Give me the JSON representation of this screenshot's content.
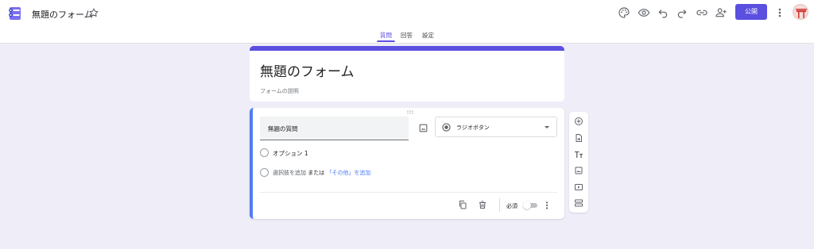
{
  "header": {
    "doc_title": "無題のフォーム",
    "publish_label": "公開",
    "tools": [
      "palette-icon",
      "eye-icon",
      "undo-icon",
      "redo-icon",
      "link-icon",
      "person-add-icon"
    ]
  },
  "tabs": [
    {
      "label": "質問",
      "active": true
    },
    {
      "label": "回答",
      "active": false
    },
    {
      "label": "設定",
      "active": false
    }
  ],
  "form": {
    "title": "無題のフォーム",
    "description_placeholder": "フォームの説明"
  },
  "question": {
    "title": "無題の質問",
    "type": "ラジオボタン",
    "options": [
      "オプション 1"
    ],
    "add_option": "選択肢を追加",
    "or": "または",
    "add_other": "「その他」を追加",
    "required_label": "必須",
    "required": false
  },
  "side_toolbar": [
    "add-circle-icon",
    "import-questions-icon",
    "title-text-icon",
    "image-icon",
    "video-icon",
    "section-icon"
  ],
  "colors": {
    "accent": "#5b4fe0",
    "question_bar": "#4f7ef2",
    "background": "#efedf8"
  }
}
